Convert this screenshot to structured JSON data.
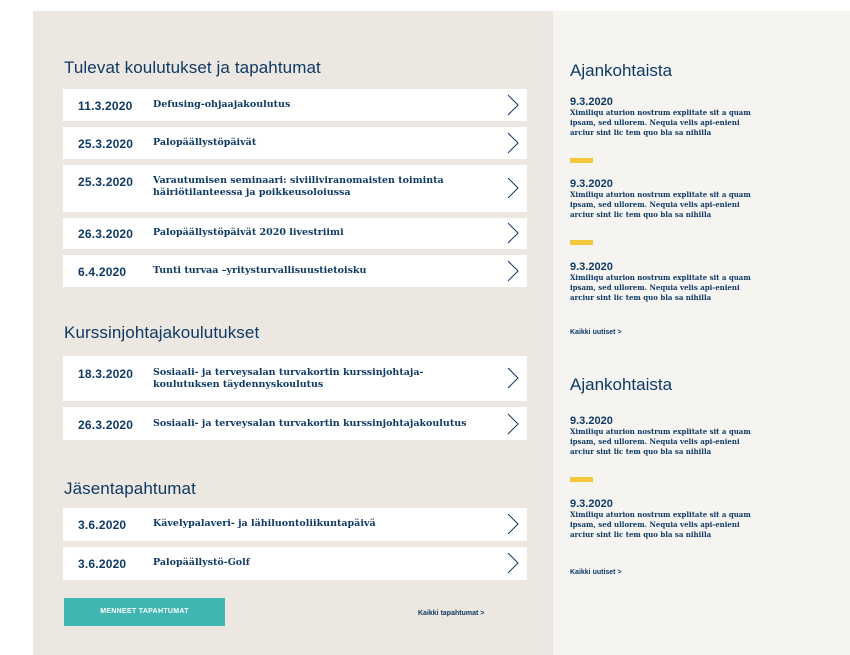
{
  "events": {
    "title": "Tulevat koulutukset ja tapahtumat",
    "items": [
      {
        "date": "11.3.2020",
        "title": "Defusing-ohjaajakoulutus"
      },
      {
        "date": "25.3.2020",
        "title": "Palopäällystöpäivät"
      },
      {
        "date": "25.3.2020",
        "title": "Varautumisen seminaari: siviiliviranomaisten toiminta häiriötilanteessa ja poikkeusoloiussa"
      },
      {
        "date": "26.3.2020",
        "title": "Palopäällystöpäivät 2020 livestriimi"
      },
      {
        "date": "6.4.2020",
        "title": "Tunti turvaa –yritysturvallisuustietoisku"
      }
    ]
  },
  "courses": {
    "title": "Kurssinjohtajakoulutukset",
    "items": [
      {
        "date": "18.3.2020",
        "title": "Sosiaali- ja terveysalan turvakortin kurssinjohtaja-koulutuksen täydennyskoulutus"
      },
      {
        "date": "26.3.2020",
        "title": "Sosiaali- ja terveysalan turvakortin kurssinjohtajakoulutus"
      }
    ]
  },
  "members": {
    "title": "Jäsentapahtumat",
    "items": [
      {
        "date": "3.6.2020",
        "title": "Kävelypalaveri- ja lähiluontoliikuntapäivä"
      },
      {
        "date": "3.6.2020",
        "title": "Palopäällystö-Golf"
      }
    ]
  },
  "footer": {
    "past_button": "MENNEET TAPAHTUMAT",
    "all_events_link": "Kaikki tapahtumat >"
  },
  "news_blocks": [
    {
      "title": "Ajankohtaista",
      "items": [
        {
          "date": "9.3.2020",
          "text": "Ximiliqu aturion nostrum explitate sit a quam ipsam, sed ullorem. Nequia velis api-enieni arciur sint lic tem quo bla sa nihilla"
        },
        {
          "date": "9.3.2020",
          "text": "Ximiliqu aturion nostrum explitate sit a quam ipsam, sed ullorem. Nequia velis api-enieni arciur sint lic tem quo bla sa nihilla"
        },
        {
          "date": "9.3.2020",
          "text": "Ximiliqu aturion nostrum explitate sit a quam ipsam, sed ullorem. Nequia velis api-enieni arciur sint lic tem quo bla sa nihilla"
        }
      ],
      "link": "Kaikki uutiset >"
    },
    {
      "title": "Ajankohtaista",
      "items": [
        {
          "date": "9.3.2020",
          "text": "Ximiliqu aturion nostrum explitate sit a quam ipsam, sed ullorem. Nequia velis api-enieni arciur sint lic tem quo bla sa nihilla"
        },
        {
          "date": "9.3.2020",
          "text": "Ximiliqu aturion nostrum explitate sit a quam ipsam, sed ullorem. Nequia velis api-enieni arciur sint lic tem quo bla sa nihilla"
        }
      ],
      "link": "Kaikki uutiset >"
    }
  ],
  "colors": {
    "primary": "#0e3a66",
    "accent_teal": "#3fb6b2",
    "accent_yellow": "#f3c63c"
  },
  "icons": {
    "row_arrow": "chevron-right-icon"
  }
}
